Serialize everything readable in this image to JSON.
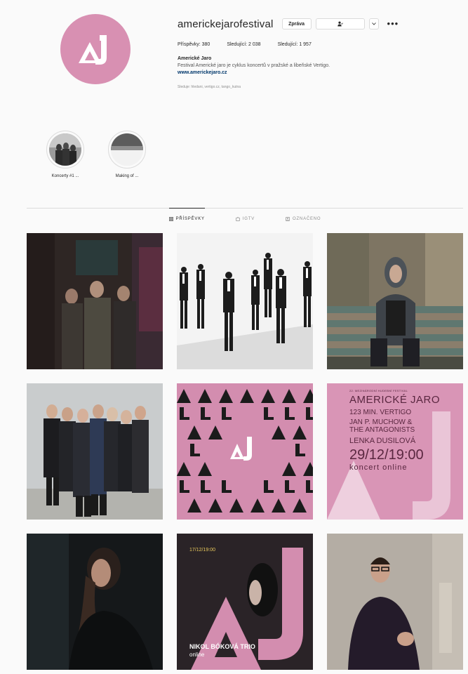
{
  "profile": {
    "username": "americkejarofestival",
    "message_label": "Zpráva",
    "follow_label": "",
    "stats": {
      "posts": "Příspěvky: 380",
      "followers": "Sledující: 2 038",
      "following": "Sledující: 1 957"
    },
    "bio_name": "Americké Jaro",
    "bio_desc": "Festival Americké jaro je cyklus koncertů v pražské a libeňské Vertigo.",
    "bio_link": "www.americkejaro.cz",
    "followed_by": "Sleduje: hledani, vertigo.cz, tango_kutna"
  },
  "highlights": [
    {
      "label": "Koncerty #1 ..."
    },
    {
      "label": "Making of ..."
    }
  ],
  "tabs": [
    {
      "label": "PŘÍSPĚVKY"
    },
    {
      "label": "IGTV"
    },
    {
      "label": "OZNAČENO"
    }
  ],
  "posts": {
    "p6": {
      "line1": "22. MEZINÁRODNÍ HUDEBNÍ FESTIVAL",
      "line2": "AMERICKÉ JARO",
      "line3": "123 MIN. VERTIGO",
      "line4": "JAN P. MUCHOW &",
      "line5": "THE ANTAGONISTS",
      "line6": "LENKA DUSILOVÁ",
      "line7": "29/12/19:00",
      "line8": "koncert online"
    },
    "p8": {
      "line1": "17/12/19:00",
      "line2": "NIKOL BÓKOVÁ TRIO",
      "line3": "online"
    }
  },
  "colors": {
    "brand_pink": "#d890b2",
    "dark": "#2a2327"
  }
}
